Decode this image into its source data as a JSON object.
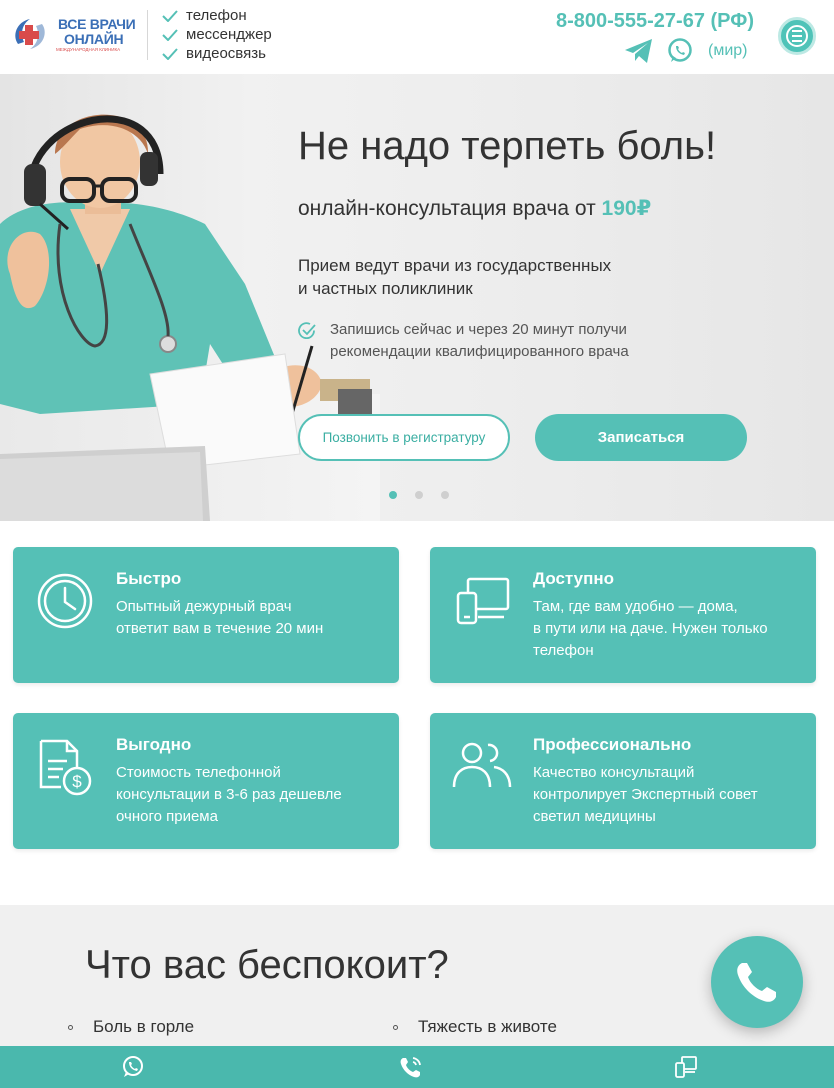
{
  "header": {
    "logo": {
      "line1": "ВСЕ ВРАЧИ",
      "line2": "ОНЛАЙН",
      "line3": "МЕЖДУНАРОДНАЯ КЛИНИКА"
    },
    "features": [
      "телефон",
      "мессенджер",
      "видеосвязь"
    ],
    "phone": "8-800-555-27-67 (РФ)",
    "world_label": "(мир)",
    "icons": {
      "telegram": "telegram-icon",
      "whatsapp": "whatsapp-icon",
      "menu": "menu-icon"
    }
  },
  "hero": {
    "title": "Не надо терпеть боль!",
    "subtitle_prefix": "онлайн-консультация  врача от ",
    "price": "190₽",
    "paragraph_line1": "Прием ведут врачи из государственных",
    "paragraph_line2": "и частных поликлиник",
    "check_line1": "Запишись сейчас и через 20 минут получи",
    "check_line2": "рекомендации квалифицированного врача",
    "btn_call": "Позвонить в регистратуру",
    "btn_signup": "Записаться",
    "slides_count": 3,
    "active_slide": 1
  },
  "cards": [
    {
      "icon": "clock-icon",
      "title": "Быстро",
      "lines": [
        "Опытный дежурный врач",
        "ответит вам в течение 20 мин"
      ]
    },
    {
      "icon": "devices-icon",
      "title": "Доступно",
      "lines": [
        "Там, где вам удобно — дома,",
        "в пути или на даче. Нужен только",
        "телефон"
      ]
    },
    {
      "icon": "document-money-icon",
      "title": "Выгодно",
      "lines": [
        "Стоимость телефонной",
        "консультации в 3-6 раз дешевле",
        "очного приема"
      ]
    },
    {
      "icon": "users-icon",
      "title": "Профессионально",
      "lines": [
        "Качество консультаций",
        "контролирует Экспертный совет",
        "светил медицины"
      ]
    }
  ],
  "worry": {
    "title": "Что вас беспокоит?",
    "items": [
      "Боль в горле",
      "Тяжесть в животе"
    ]
  },
  "bottom_bar": {
    "items": [
      "whatsapp-icon",
      "phone-call-icon",
      "mobile-devices-icon"
    ]
  },
  "colors": {
    "accent": "#55c0b6",
    "accent_dark": "#4ab8ad",
    "logo_blue": "#3b6fb6",
    "logo_red": "#d94b4b"
  }
}
